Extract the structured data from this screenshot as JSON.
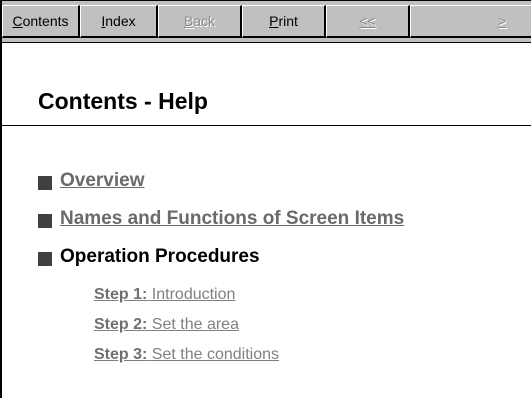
{
  "toolbar": {
    "buttons": [
      {
        "label": "Contents",
        "mnemonic": "C",
        "rest": "ontents",
        "enabled": true
      },
      {
        "label": "Index",
        "mnemonic": "I",
        "rest": "ndex",
        "enabled": true
      },
      {
        "label": "Back",
        "mnemonic": "B",
        "rest": "ack",
        "enabled": false
      },
      {
        "label": "Print",
        "mnemonic": "P",
        "rest": "rint",
        "enabled": true
      },
      {
        "label": "<<",
        "mnemonic": "<",
        "rest": "<",
        "enabled": false
      },
      {
        "label": ">",
        "mnemonic": ">",
        "rest": "",
        "enabled": false
      }
    ]
  },
  "page": {
    "title": "Contents - Help"
  },
  "toc": {
    "items": [
      {
        "label": "Overview",
        "is_link": true
      },
      {
        "label": "Names and Functions of Screen Items",
        "is_link": true
      },
      {
        "label": "Operation Procedures",
        "is_link": false
      }
    ],
    "steps": [
      {
        "num": "Step 1:",
        "text": "Introduction"
      },
      {
        "num": "Step 2:",
        "text": "Set the area"
      },
      {
        "num": "Step 3:",
        "text": "Set the conditions"
      }
    ]
  },
  "colors": {
    "toolbar_bg": "#c0c0c0",
    "link": "#6a6a6a",
    "bullet": "#404040"
  }
}
